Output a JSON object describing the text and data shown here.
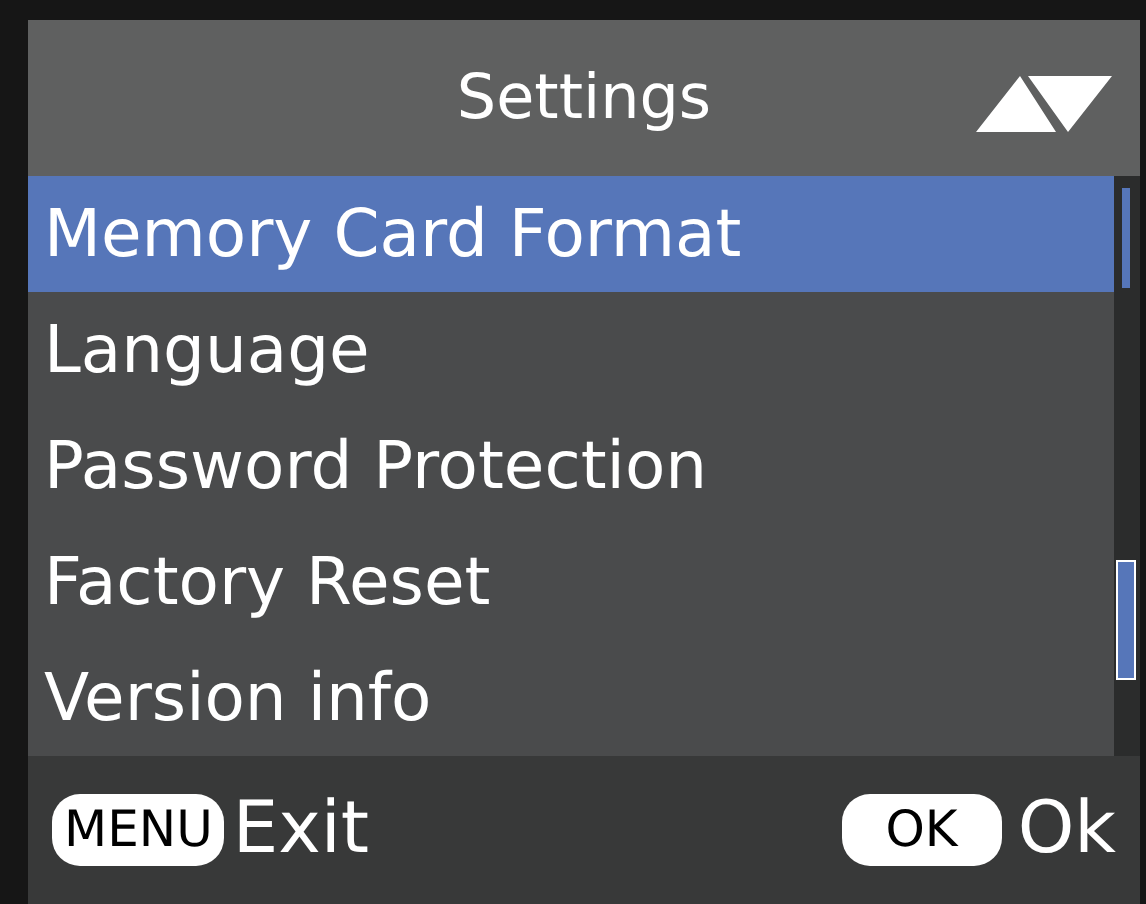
{
  "header": {
    "title": "Settings"
  },
  "menu_items": [
    {
      "label": "Memory Card Format",
      "selected": true
    },
    {
      "label": "Language",
      "selected": false
    },
    {
      "label": "Password Protection",
      "selected": false
    },
    {
      "label": "Factory Reset",
      "selected": false
    },
    {
      "label": "Version info",
      "selected": false
    }
  ],
  "footer": {
    "left_key": "MENU",
    "left_action": "Exit",
    "right_key": "OK",
    "right_action": "Ok"
  }
}
